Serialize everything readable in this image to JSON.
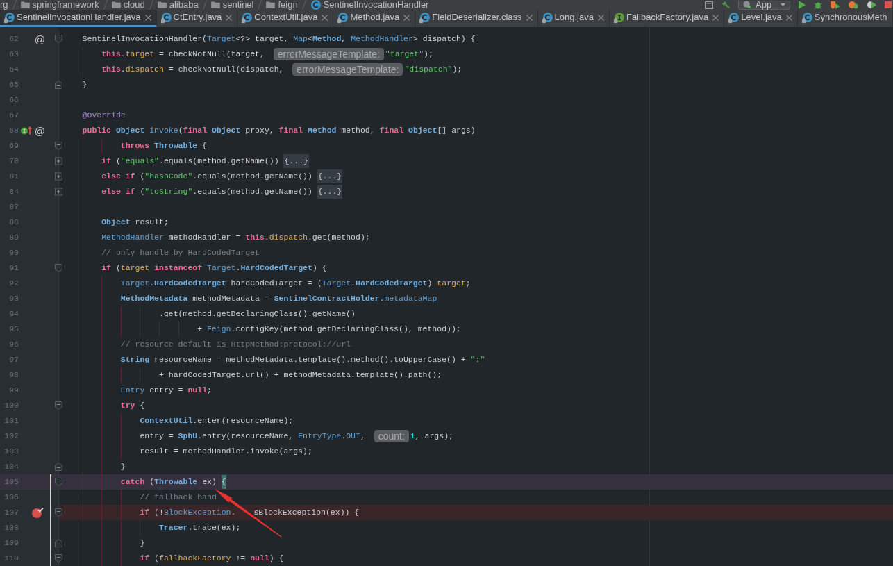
{
  "breadcrumbs": [
    {
      "label": "rg"
    },
    {
      "label": "springframework",
      "kind": "folder"
    },
    {
      "label": "cloud",
      "kind": "folder"
    },
    {
      "label": "alibaba",
      "kind": "folder"
    },
    {
      "label": "sentinel",
      "kind": "folder"
    },
    {
      "label": "feign",
      "kind": "folder"
    },
    {
      "label": "SentinelInvocationHandler",
      "kind": "class"
    }
  ],
  "toolbar": {
    "run_configuration": "App"
  },
  "tabs": [
    {
      "label": "SentinelInvocationHandler.java",
      "kind": "class",
      "selected": true,
      "closable": true
    },
    {
      "label": "CtEntry.java",
      "kind": "class",
      "selected": false,
      "closable": true
    },
    {
      "label": "ContextUtil.java",
      "kind": "class",
      "selected": false,
      "closable": true
    },
    {
      "label": "Method.java",
      "kind": "class",
      "selected": false,
      "closable": true
    },
    {
      "label": "FieldDeserializer.class",
      "kind": "class",
      "selected": false,
      "closable": true
    },
    {
      "label": "Long.java",
      "kind": "class",
      "selected": false,
      "closable": true
    },
    {
      "label": "FallbackFactory.java",
      "kind": "interface",
      "selected": false,
      "closable": true
    },
    {
      "label": "Level.java",
      "kind": "class",
      "selected": false,
      "closable": true
    },
    {
      "label": "SynchronousMeth",
      "kind": "class",
      "selected": false,
      "closable": false
    }
  ],
  "editor": {
    "lines": [
      {
        "number": "62",
        "gutter": [
          {
            "kind": "mark",
            "text": "@"
          }
        ],
        "fold": {
          "kind": "start"
        },
        "current": false,
        "breakpoint": false,
        "tokens": [
          {
            "kind": "plain",
            "text": "    SentinelInvocationHandler("
          },
          {
            "kind": "type",
            "text": "Target"
          },
          {
            "kind": "plain",
            "text": "<?> target, "
          },
          {
            "kind": "type",
            "text": "Map"
          },
          {
            "kind": "plain",
            "text": "<"
          },
          {
            "kind": "class",
            "text": "Method"
          },
          {
            "kind": "plain",
            "text": ", "
          },
          {
            "kind": "type",
            "text": "MethodHandler"
          },
          {
            "kind": "plain",
            "text": "> dispatch) {"
          }
        ]
      },
      {
        "number": "63",
        "current": false,
        "breakpoint": false,
        "tokens": [
          {
            "kind": "keyword",
            "text": "        this"
          },
          {
            "kind": "plain",
            "text": "."
          },
          {
            "kind": "field",
            "text": "target"
          },
          {
            "kind": "plain",
            "text": " = checkNotNull(target, "
          },
          {
            "kind": "hint",
            "text": "errorMessageTemplate:"
          },
          {
            "kind": "string",
            "text": "\"target\""
          },
          {
            "kind": "plain",
            "text": ");"
          }
        ]
      },
      {
        "number": "64",
        "current": false,
        "breakpoint": false,
        "tokens": [
          {
            "kind": "keyword",
            "text": "        this"
          },
          {
            "kind": "plain",
            "text": "."
          },
          {
            "kind": "field",
            "text": "dispatch"
          },
          {
            "kind": "plain",
            "text": " = checkNotNull(dispatch, "
          },
          {
            "kind": "hint",
            "text": "errorMessageTemplate:"
          },
          {
            "kind": "string",
            "text": "\"dispatch\""
          },
          {
            "kind": "plain",
            "text": ");"
          }
        ]
      },
      {
        "number": "65",
        "fold": {
          "kind": "end"
        },
        "current": false,
        "breakpoint": false,
        "tokens": [
          {
            "kind": "plain",
            "text": "    }"
          }
        ]
      },
      {
        "number": "66",
        "current": false,
        "breakpoint": false
      },
      {
        "number": "67",
        "current": false,
        "breakpoint": false,
        "tokens": [
          {
            "kind": "annotation",
            "text": "    @Override"
          }
        ]
      },
      {
        "number": "68",
        "gutter": [
          {
            "kind": "implements"
          },
          {
            "kind": "mark",
            "text": "@"
          }
        ],
        "current": false,
        "breakpoint": false,
        "tokens": [
          {
            "kind": "keyword",
            "text": "    public "
          },
          {
            "kind": "class",
            "text": "Object "
          },
          {
            "kind": "type",
            "text": "invoke"
          },
          {
            "kind": "plain",
            "text": "("
          },
          {
            "kind": "keyword",
            "text": "final "
          },
          {
            "kind": "class",
            "text": "Object"
          },
          {
            "kind": "plain",
            "text": " proxy, "
          },
          {
            "kind": "keyword",
            "text": "final "
          },
          {
            "kind": "class",
            "text": "Method"
          },
          {
            "kind": "plain",
            "text": " method, "
          },
          {
            "kind": "keyword",
            "text": "final "
          },
          {
            "kind": "class",
            "text": "Object"
          },
          {
            "kind": "plain",
            "text": "[] args)"
          }
        ]
      },
      {
        "number": "69",
        "fold": {
          "kind": "start"
        },
        "current": false,
        "breakpoint": false,
        "tokens": [
          {
            "kind": "keyword",
            "text": "            throws "
          },
          {
            "kind": "class",
            "text": "Throwable"
          },
          {
            "kind": "plain",
            "text": " {"
          }
        ]
      },
      {
        "number": "70",
        "fold": {
          "kind": "collapsed"
        },
        "current": false,
        "breakpoint": false,
        "tokens": [
          {
            "kind": "keyword",
            "text": "        if"
          },
          {
            "kind": "plain",
            "text": " ("
          },
          {
            "kind": "string",
            "text": "\"equals\""
          },
          {
            "kind": "plain",
            "text": ".equals(method.getName()) "
          },
          {
            "kind": "fold",
            "text": "{...}"
          }
        ]
      },
      {
        "number": "81",
        "fold": {
          "kind": "collapsed"
        },
        "current": false,
        "breakpoint": false,
        "tokens": [
          {
            "kind": "keyword",
            "text": "        else if"
          },
          {
            "kind": "plain",
            "text": " ("
          },
          {
            "kind": "string",
            "text": "\"hashCode\""
          },
          {
            "kind": "plain",
            "text": ".equals(method.getName()) "
          },
          {
            "kind": "fold",
            "text": "{...}"
          }
        ]
      },
      {
        "number": "84",
        "fold": {
          "kind": "collapsed"
        },
        "current": false,
        "breakpoint": false,
        "tokens": [
          {
            "kind": "keyword",
            "text": "        else if"
          },
          {
            "kind": "plain",
            "text": " ("
          },
          {
            "kind": "string",
            "text": "\"toString\""
          },
          {
            "kind": "plain",
            "text": ".equals(method.getName()) "
          },
          {
            "kind": "fold",
            "text": "{...}"
          }
        ]
      },
      {
        "number": "87",
        "current": false,
        "breakpoint": false
      },
      {
        "number": "88",
        "current": false,
        "breakpoint": false,
        "tokens": [
          {
            "kind": "class",
            "text": "        Object"
          },
          {
            "kind": "plain",
            "text": " result;"
          }
        ]
      },
      {
        "number": "89",
        "current": false,
        "breakpoint": false,
        "tokens": [
          {
            "kind": "type",
            "text": "        MethodHandler"
          },
          {
            "kind": "plain",
            "text": " methodHandler = "
          },
          {
            "kind": "keyword",
            "text": "this"
          },
          {
            "kind": "plain",
            "text": "."
          },
          {
            "kind": "field",
            "text": "dispatch"
          },
          {
            "kind": "plain",
            "text": ".get(method);"
          }
        ]
      },
      {
        "number": "90",
        "current": false,
        "breakpoint": false,
        "tokens": [
          {
            "kind": "comment",
            "text": "        // only handle by HardCodedTarget"
          }
        ]
      },
      {
        "number": "91",
        "fold": {
          "kind": "start"
        },
        "current": false,
        "breakpoint": false,
        "tokens": [
          {
            "kind": "keyword",
            "text": "        if"
          },
          {
            "kind": "plain",
            "text": " ("
          },
          {
            "kind": "field",
            "text": "target"
          },
          {
            "kind": "keyword",
            "text": " instanceof "
          },
          {
            "kind": "type",
            "text": "Target"
          },
          {
            "kind": "plain",
            "text": "."
          },
          {
            "kind": "class",
            "text": "HardCodedTarget"
          },
          {
            "kind": "plain",
            "text": ") {"
          }
        ]
      },
      {
        "number": "92",
        "current": false,
        "breakpoint": false,
        "tokens": [
          {
            "kind": "type",
            "text": "            Target"
          },
          {
            "kind": "plain",
            "text": "."
          },
          {
            "kind": "class",
            "text": "HardCodedTarget"
          },
          {
            "kind": "plain",
            "text": " hardCodedTarget = ("
          },
          {
            "kind": "type",
            "text": "Target"
          },
          {
            "kind": "plain",
            "text": "."
          },
          {
            "kind": "class",
            "text": "HardCodedTarget"
          },
          {
            "kind": "plain",
            "text": ") "
          },
          {
            "kind": "field",
            "text": "target"
          },
          {
            "kind": "plain",
            "text": ";"
          }
        ]
      },
      {
        "number": "93",
        "current": false,
        "breakpoint": false,
        "tokens": [
          {
            "kind": "class",
            "text": "            MethodMetadata"
          },
          {
            "kind": "plain",
            "text": " methodMetadata = "
          },
          {
            "kind": "class",
            "text": "SentinelContractHolder"
          },
          {
            "kind": "plain",
            "text": "."
          },
          {
            "kind": "type",
            "text": "metadataMap"
          }
        ]
      },
      {
        "number": "94",
        "current": false,
        "breakpoint": false,
        "tokens": [
          {
            "kind": "plain",
            "text": "                    .get(method.getDeclaringClass().getName()"
          }
        ]
      },
      {
        "number": "95",
        "current": false,
        "breakpoint": false,
        "tokens": [
          {
            "kind": "plain",
            "text": "                            + "
          },
          {
            "kind": "type",
            "text": "Feign"
          },
          {
            "kind": "plain",
            "text": ".configKey(method.getDeclaringClass(), method));"
          }
        ]
      },
      {
        "number": "96",
        "current": false,
        "breakpoint": false,
        "tokens": [
          {
            "kind": "comment",
            "text": "            // resource default is HttpMethod:protocol://url"
          }
        ]
      },
      {
        "number": "97",
        "current": false,
        "breakpoint": false,
        "tokens": [
          {
            "kind": "class",
            "text": "            String"
          },
          {
            "kind": "plain",
            "text": " resourceName = methodMetadata.template().method().toUpperCase() + "
          },
          {
            "kind": "string",
            "text": "\":\""
          }
        ]
      },
      {
        "number": "98",
        "current": false,
        "breakpoint": false,
        "tokens": [
          {
            "kind": "plain",
            "text": "                    + hardCodedTarget.url() + methodMetadata.template().path();"
          }
        ]
      },
      {
        "number": "99",
        "current": false,
        "breakpoint": false,
        "tokens": [
          {
            "kind": "type",
            "text": "            Entry"
          },
          {
            "kind": "plain",
            "text": " entry = "
          },
          {
            "kind": "keyword",
            "text": "null"
          },
          {
            "kind": "plain",
            "text": ";"
          }
        ]
      },
      {
        "number": "100",
        "fold": {
          "kind": "start"
        },
        "current": false,
        "breakpoint": false,
        "tokens": [
          {
            "kind": "keyword",
            "text": "            try"
          },
          {
            "kind": "plain",
            "text": " {"
          }
        ]
      },
      {
        "number": "101",
        "current": false,
        "breakpoint": false,
        "tokens": [
          {
            "kind": "class",
            "text": "                ContextUtil"
          },
          {
            "kind": "plain",
            "text": ".enter(resourceName);"
          }
        ]
      },
      {
        "number": "102",
        "current": false,
        "breakpoint": false,
        "tokens": [
          {
            "kind": "plain",
            "text": "                entry = "
          },
          {
            "kind": "class",
            "text": "SphU"
          },
          {
            "kind": "plain",
            "text": ".entry(resourceName, "
          },
          {
            "kind": "type",
            "text": "EntryType"
          },
          {
            "kind": "plain",
            "text": "."
          },
          {
            "kind": "type",
            "text": "OUT"
          },
          {
            "kind": "plain",
            "text": ", "
          },
          {
            "kind": "hint",
            "text": "count:"
          },
          {
            "kind": "number",
            "text": "1"
          },
          {
            "kind": "plain",
            "text": ", args);"
          }
        ]
      },
      {
        "number": "103",
        "current": false,
        "breakpoint": false,
        "tokens": [
          {
            "kind": "plain",
            "text": "                result = methodHandler.invoke(args);"
          }
        ]
      },
      {
        "number": "104",
        "fold": {
          "kind": "end"
        },
        "current": false,
        "breakpoint": false,
        "tokens": [
          {
            "kind": "plain",
            "text": "            }"
          }
        ]
      },
      {
        "number": "105",
        "fold": {
          "kind": "start"
        },
        "current": true,
        "breakpoint": false,
        "tokens": [
          {
            "kind": "keyword",
            "text": "            catch"
          },
          {
            "kind": "plain",
            "text": " ("
          },
          {
            "kind": "class",
            "text": "Throwable"
          },
          {
            "kind": "plain",
            "text": " ex) "
          },
          {
            "kind": "brace",
            "text": "{"
          }
        ]
      },
      {
        "number": "106",
        "current": false,
        "breakpoint": false,
        "tokens": [
          {
            "kind": "comment",
            "text": "                // fallback hand"
          }
        ]
      },
      {
        "number": "107",
        "fold": {
          "kind": "start"
        },
        "current": false,
        "breakpoint": true,
        "tokens": [
          {
            "kind": "keyword",
            "text": "                if"
          },
          {
            "kind": "plain",
            "text": " (!"
          },
          {
            "kind": "type",
            "text": "BlockException"
          },
          {
            "kind": "plain",
            "text": "."
          },
          {
            "kind": "covered"
          },
          {
            "kind": "plain",
            "text": "sBlockException(ex)) {"
          }
        ]
      },
      {
        "number": "108",
        "current": false,
        "breakpoint": false,
        "tokens": [
          {
            "kind": "class",
            "text": "                    Tracer"
          },
          {
            "kind": "plain",
            "text": ".trace(ex);"
          }
        ]
      },
      {
        "number": "109",
        "fold": {
          "kind": "end"
        },
        "current": false,
        "breakpoint": false,
        "tokens": [
          {
            "kind": "plain",
            "text": "                }"
          }
        ]
      },
      {
        "number": "110",
        "fold": {
          "kind": "start"
        },
        "current": false,
        "breakpoint": false,
        "tokens": [
          {
            "kind": "keyword",
            "text": "                if"
          },
          {
            "kind": "plain",
            "text": " ("
          },
          {
            "kind": "field",
            "text": "fallbackFactory"
          },
          {
            "kind": "plain",
            "text": " != "
          },
          {
            "kind": "keyword",
            "text": "null"
          },
          {
            "kind": "plain",
            "text": ") {"
          }
        ]
      }
    ]
  }
}
